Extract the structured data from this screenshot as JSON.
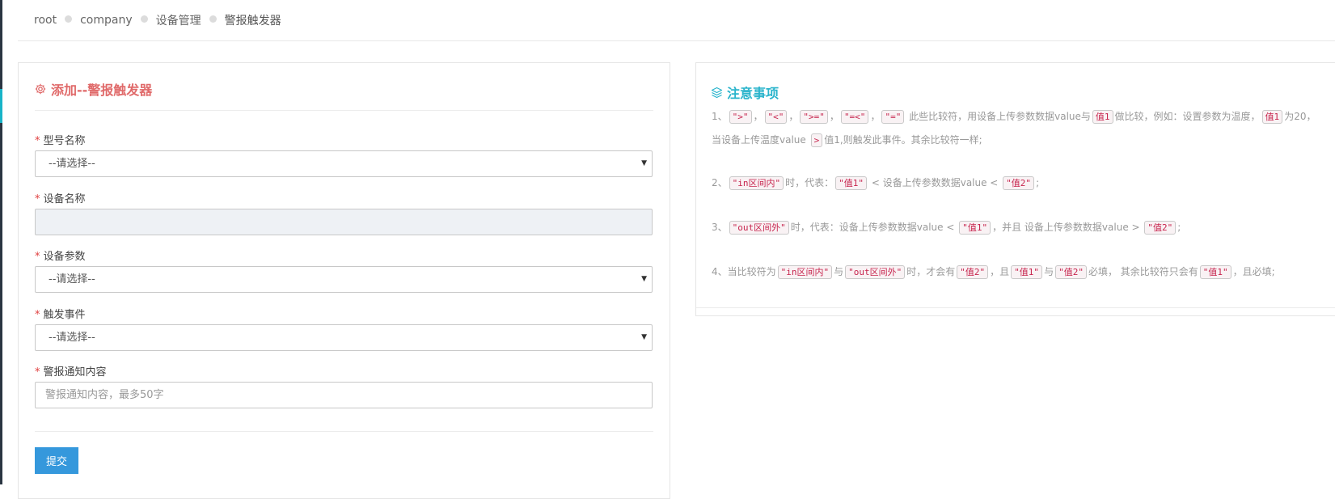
{
  "breadcrumb": {
    "items": [
      "root",
      "company",
      "设备管理",
      "警报触发器"
    ]
  },
  "form": {
    "title": "添加--警报触发器",
    "fields": [
      {
        "label": "型号名称",
        "type": "select",
        "value": "--请选择--"
      },
      {
        "label": "设备名称",
        "type": "input-disabled",
        "value": ""
      },
      {
        "label": "设备参数",
        "type": "select",
        "value": "--请选择--"
      },
      {
        "label": "触发事件",
        "type": "select",
        "value": "--请选择--"
      },
      {
        "label": "警报通知内容",
        "type": "input",
        "value": "",
        "placeholder": "警报通知内容，最多50字"
      }
    ],
    "submit_label": "提交"
  },
  "notes": {
    "title": "注意事项",
    "n1": {
      "prefix": "1、",
      "c1": "\">\"",
      "s1": "，",
      "c2": "\"<\"",
      "s2": "，",
      "c3": "\">=\"",
      "s3": "，",
      "c4": "\"=<\"",
      "s4": "，",
      "c5": "\"=\"",
      "t1": " 此些比较符，用设备上传参数数据value与",
      "c6": "值1",
      "t2": "做比较，例如：设置参数为温度，",
      "c7": "值1",
      "t3": "为20，当设备上传温度value ",
      "c8": ">",
      "t4": "值1,则触发此事件。其余比较符一样;"
    },
    "n2": {
      "prefix": "2、",
      "c1": "\"in区间内\"",
      "t1": "时，代表：",
      "c2": "\"值1\"",
      "t2": " < 设备上传参数数据value < ",
      "c3": "\"值2\"",
      "t3": ";"
    },
    "n3": {
      "prefix": "3、",
      "c1": "\"out区间外\"",
      "t1": "时，代表：设备上传参数数据value < ",
      "c2": "\"值1\"",
      "t2": "，并且 设备上传参数数据value > ",
      "c3": "\"值2\"",
      "t3": ";"
    },
    "n4": {
      "prefix": "4、当比较符为",
      "c1": "\"in区间内\"",
      "t1": "与",
      "c2": "\"out区间外\"",
      "t2": "时，才会有",
      "c3": "\"值2\"",
      "t3": "，且",
      "c4": "\"值1\"",
      "t4": "与",
      "c5": "\"值2\"",
      "t5": "必填， 其余比较符只会有",
      "c6": "\"值1\"",
      "t6": "，且必填;"
    }
  },
  "colors": {
    "form_title": "#e06a6a",
    "notes_title": "#2ab4cc",
    "submit_bg": "#3598dc",
    "required": "#e04040",
    "code_text": "#c7254e"
  },
  "icons": {
    "form_title": "gear-icon",
    "notes_title": "layers-icon",
    "select_caret": "caret-down-icon"
  }
}
